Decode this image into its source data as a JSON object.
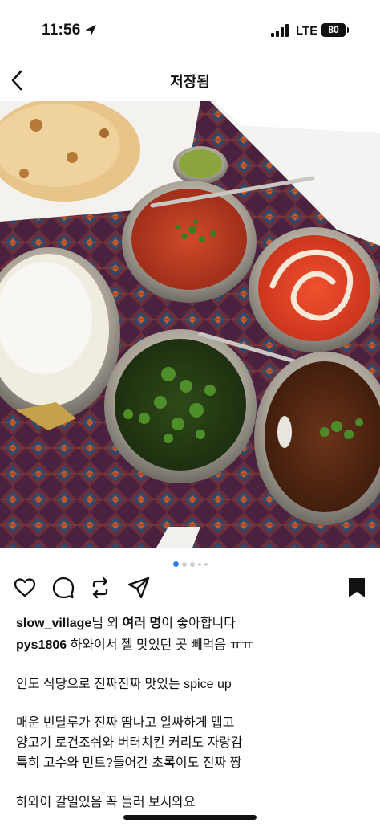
{
  "status_bar": {
    "time": "11:56",
    "network": "LTE",
    "battery": "80"
  },
  "nav": {
    "title": "저장됨"
  },
  "photo": {
    "description_icon": "indian-food-photo"
  },
  "carousel": {
    "total_dots": 5,
    "active_index": 0
  },
  "likes": {
    "user": "slow_village",
    "middle": "님 외 ",
    "others": "여러 명",
    "suffix": "이 좋아합니다"
  },
  "comment": {
    "user": "pys1806",
    "text": " 하와이서 젤 맛있던 곳 빼먹음 ㅠㅠ"
  },
  "caption": [
    "인도 식당으로 진짜진짜 맛있는 spice up",
    "매운 빈달루가 진짜 땀나고 알싸하게 맵고",
    "양고기 로건조쉬와 버터치킨 커리도 자랑감",
    "특히 고수와 민트?들어간 초록이도 진짜 짱",
    "하와이 갈일있음 꼭 들러 보시와요"
  ],
  "colors": {
    "accent": "#2f7cf6",
    "text": "#111111"
  }
}
